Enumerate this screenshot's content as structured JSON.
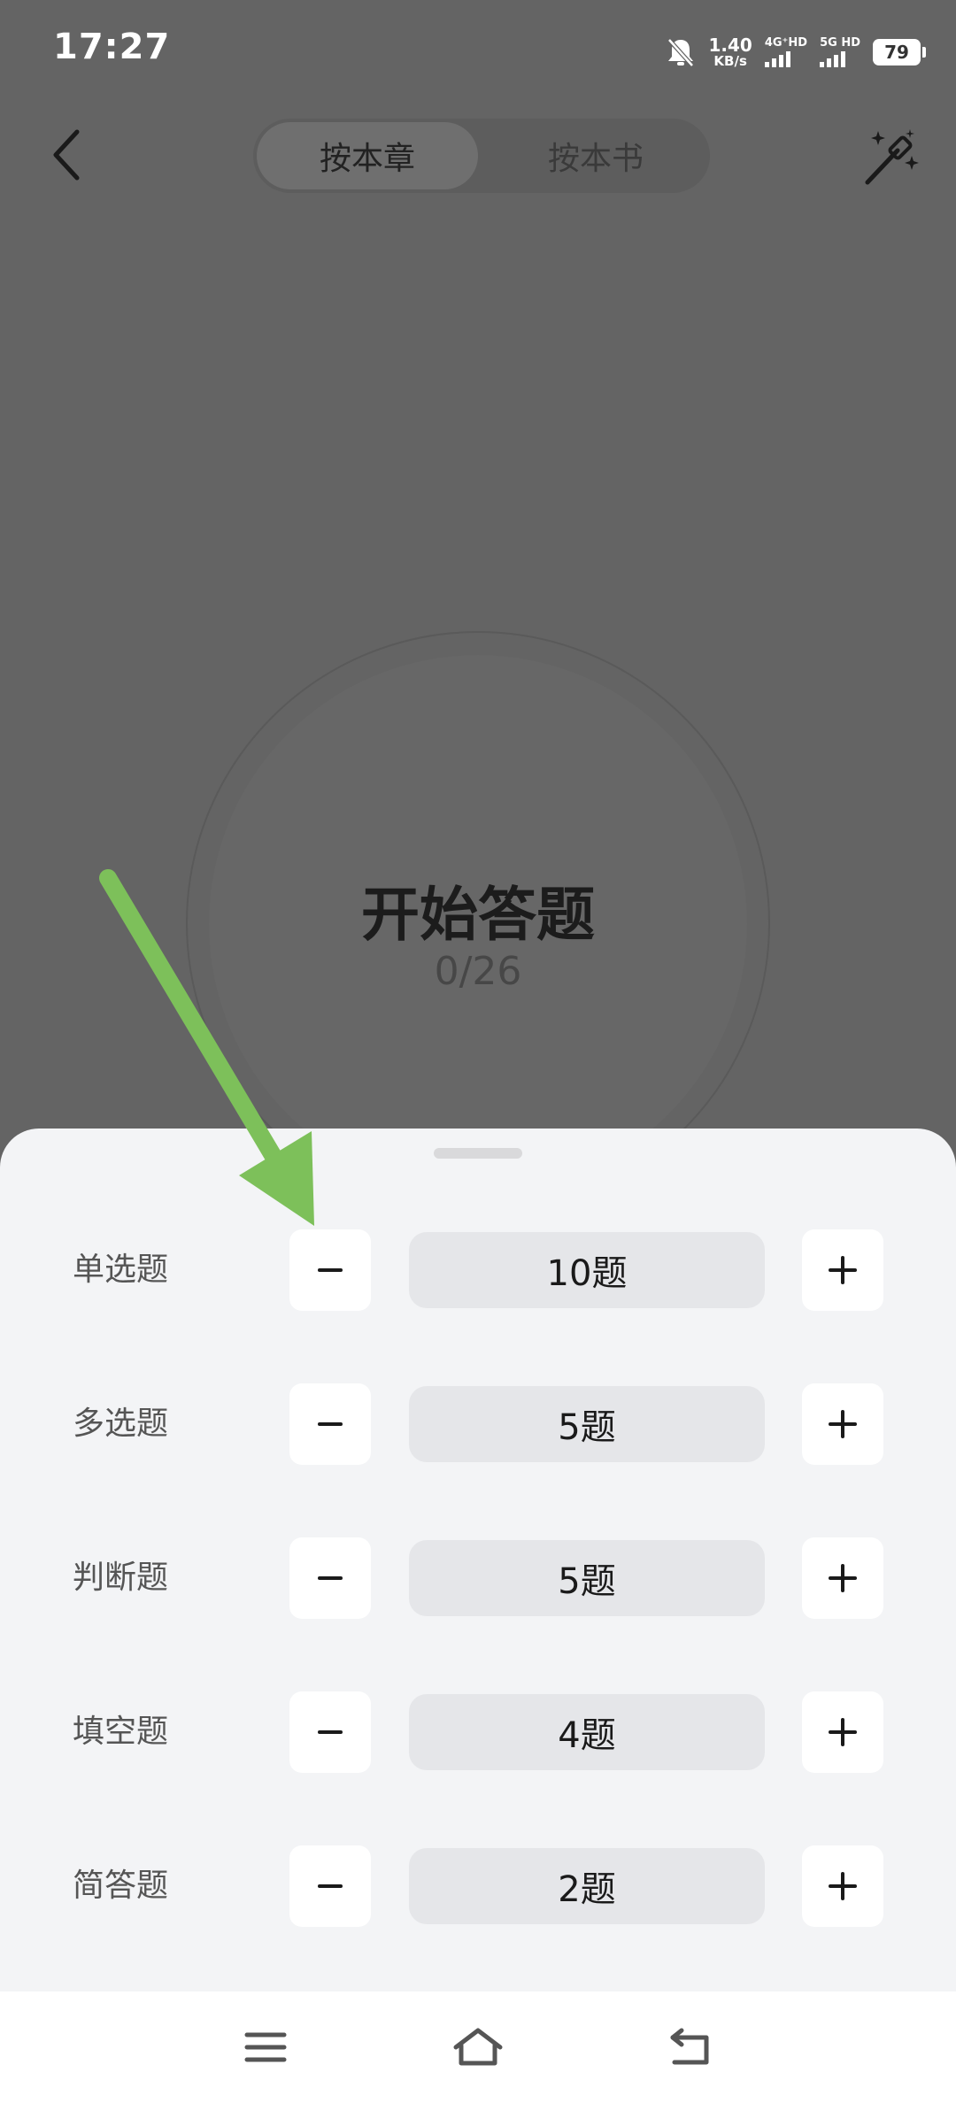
{
  "status_bar": {
    "time": "17:27",
    "net_speed_value": "1.40",
    "net_speed_unit": "KB/s",
    "sim1_label": "4G⁺HD",
    "sim2_label": "5G HD",
    "battery": "79"
  },
  "header": {
    "tabs": [
      {
        "label": "按本章",
        "active": true
      },
      {
        "label": "按本书",
        "active": false
      }
    ]
  },
  "start": {
    "title": "开始答题",
    "progress": "0/26"
  },
  "sheet": {
    "rows": [
      {
        "label": "单选题",
        "value": "10题"
      },
      {
        "label": "多选题",
        "value": "5题"
      },
      {
        "label": "判断题",
        "value": "5题"
      },
      {
        "label": "填空题",
        "value": "4题"
      },
      {
        "label": "简答题",
        "value": "2题"
      }
    ]
  },
  "colors": {
    "overlay": "#646464",
    "sheet_bg": "#f3f4f6",
    "annotation_arrow": "#7dc05a"
  },
  "icons": [
    "back-icon",
    "magic-wand-icon",
    "minus-icon",
    "plus-icon",
    "menu-icon",
    "home-icon",
    "return-icon",
    "bell-muted-icon"
  ]
}
